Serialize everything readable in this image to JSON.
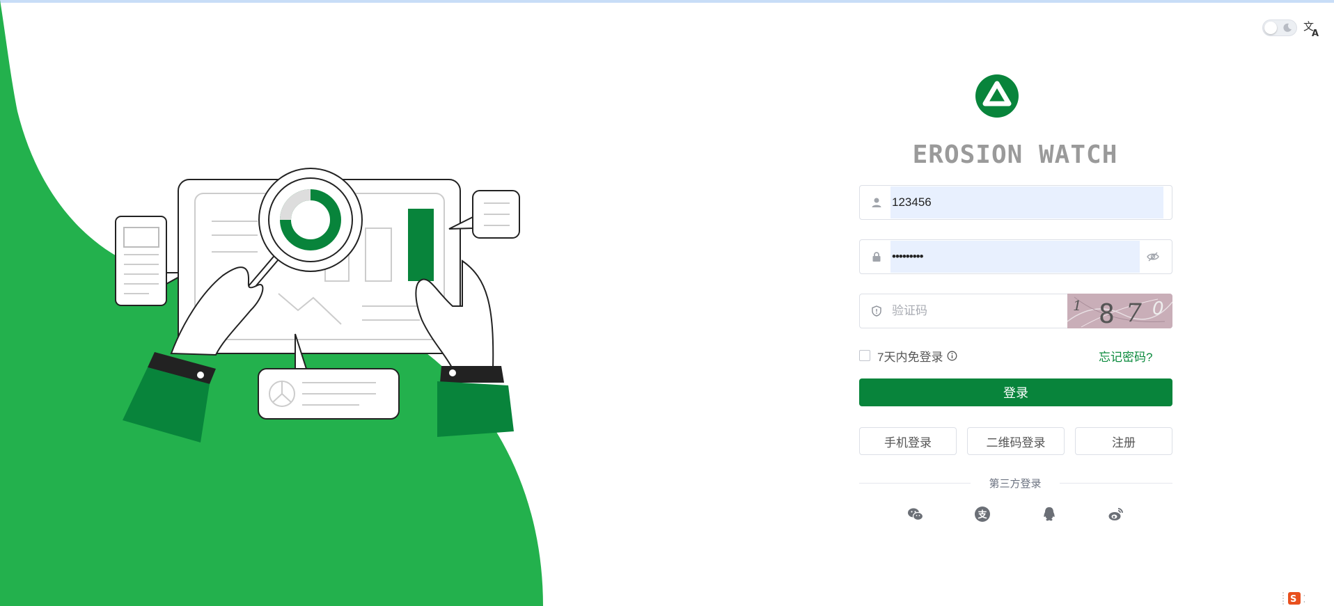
{
  "app": {
    "title": "EROSION WATCH",
    "logo_icon": "triangle-logo",
    "accent_color": "#08843b",
    "background_green": "#23b14d"
  },
  "header": {
    "theme_toggle_icon": "moon-icon",
    "language_icon": "translate-icon"
  },
  "form": {
    "username": {
      "icon": "user-icon",
      "value": "123456"
    },
    "password": {
      "icon": "lock-icon",
      "value": "•••••••••",
      "toggle_icon": "eye-off-icon"
    },
    "captcha": {
      "icon": "shield-icon",
      "placeholder": "验证码",
      "image_text": "1870"
    },
    "remember_label": "7天内免登录",
    "remember_info_icon": "info-icon",
    "forgot_label": "忘记密码?",
    "login_label": "登录"
  },
  "alt_login": {
    "phone_label": "手机登录",
    "qrcode_label": "二维码登录",
    "register_label": "注册"
  },
  "third_party": {
    "label": "第三方登录",
    "icons": [
      "wechat-icon",
      "alipay-icon",
      "qq-icon",
      "weibo-icon"
    ]
  }
}
